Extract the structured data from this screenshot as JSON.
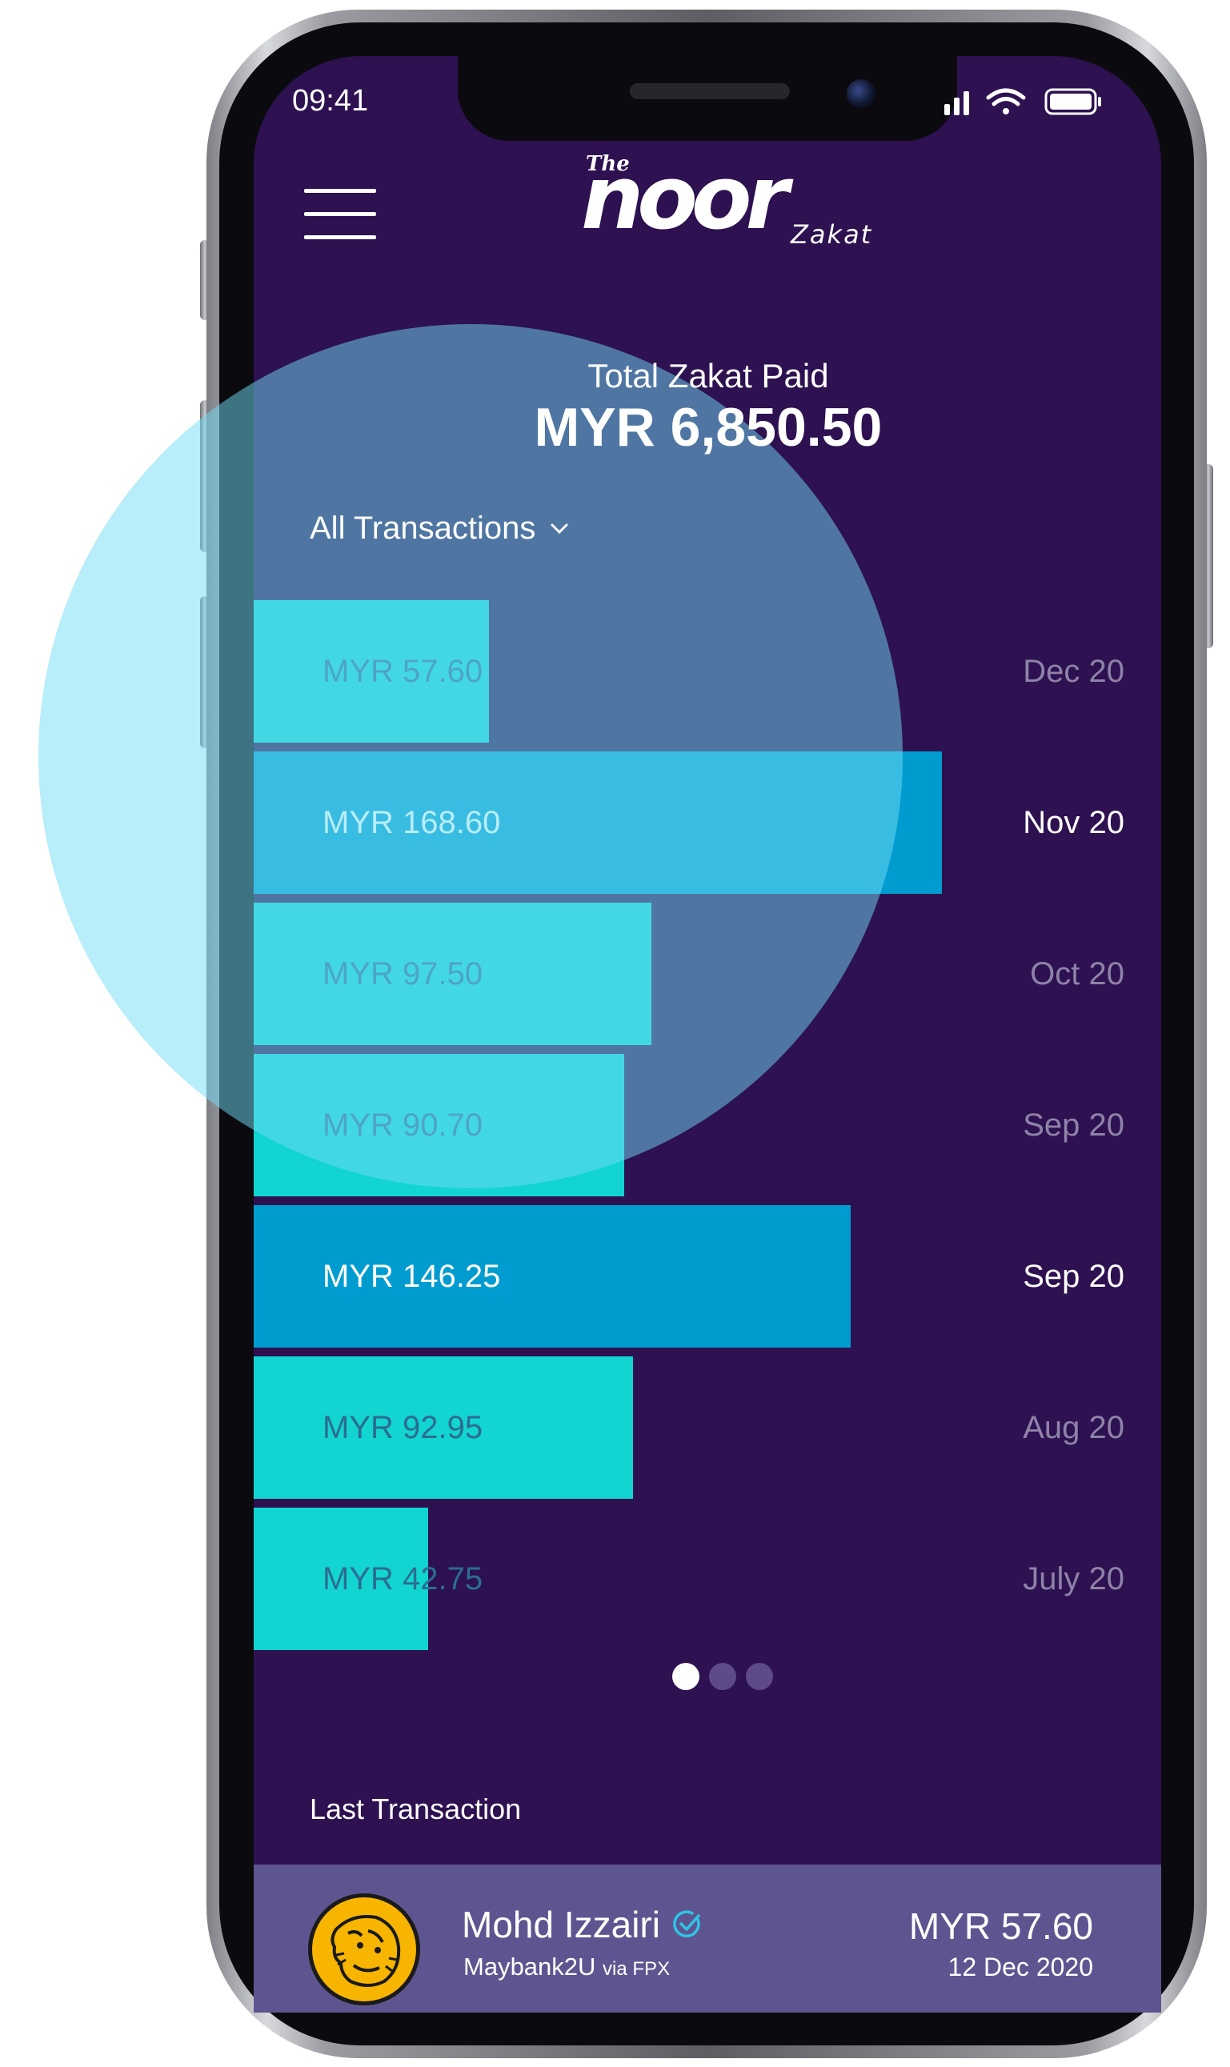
{
  "status_bar": {
    "time": "09:41",
    "icons": [
      "signal-icon",
      "wifi-icon",
      "battery-icon"
    ]
  },
  "header": {
    "logo_the": "The",
    "logo_noor": "noor",
    "logo_zakat": "Zakat"
  },
  "summary": {
    "label": "Total Zakat Paid",
    "value": "MYR 6,850.50"
  },
  "filter": {
    "label": "All Transactions"
  },
  "colors": {
    "background": "#2d1150",
    "bar_light": "#12d4d0",
    "bar_dark": "#019ccf",
    "card": "#5e5590",
    "bubble": "#72dcf6"
  },
  "chart_data": {
    "type": "bar",
    "orientation": "horizontal",
    "categories": [
      "Dec 20",
      "Nov 20",
      "Oct 20",
      "Sep 20",
      "Sep 20",
      "Aug 20",
      "July 20"
    ],
    "values": [
      57.6,
      168.6,
      97.5,
      90.7,
      146.25,
      92.95,
      42.75
    ],
    "labels": [
      "MYR 57.60",
      "MYR 168.60",
      "MYR 97.50",
      "MYR 90.70",
      "MYR 146.25",
      "MYR 92.95",
      "MYR 42.75"
    ],
    "highlighted": [
      false,
      true,
      false,
      false,
      true,
      false,
      false
    ]
  },
  "pagination": {
    "count": 3,
    "active": 0
  },
  "last_transaction": {
    "section_label": "Last Transaction",
    "name": "Mohd Izzairi",
    "bank": "Maybank2U",
    "via": "via FPX",
    "amount": "MYR 57.60",
    "date": "12 Dec 2020"
  }
}
